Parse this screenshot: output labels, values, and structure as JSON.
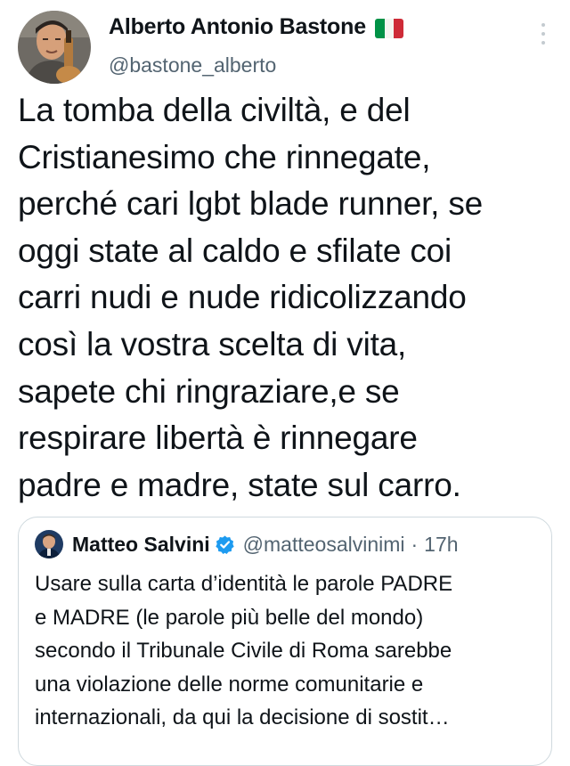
{
  "author": {
    "display_name": "Alberto Antonio Bastone",
    "handle": "@bastone_alberto",
    "flag_colors": [
      "#009246",
      "#ffffff",
      "#ce2b37"
    ]
  },
  "tweet": {
    "lines": [
      "La tomba della civiltà, e del",
      "Cristianesimo che rinnegate,",
      "perché cari lgbt blade runner, se",
      "oggi state al caldo e sfilate coi",
      "carri nudi e nude ridicolizzando",
      "così la vostra scelta di vita,",
      "sapete chi ringraziare,e se",
      "respirare libertà è rinnegare",
      "padre e madre, state sul carro."
    ]
  },
  "quoted": {
    "display_name": "Matteo Salvini",
    "handle": "@matteosalvinimi",
    "separator": "·",
    "time": "17h",
    "lines": [
      "Usare sulla carta d’identità le parole PADRE",
      "e MADRE (le parole più belle del mondo)",
      "secondo il Tribunale Civile di Roma sarebbe",
      "una violazione delle norme comunitarie e",
      "internazionali, da qui la decisione di sostit…"
    ]
  },
  "icons": {
    "more": "more-options-icon",
    "verified": "verified-badge-icon",
    "flag": "italy-flag-icon"
  },
  "colors": {
    "text": "#0f1419",
    "secondary": "#536471",
    "border": "#cfd9de",
    "verified": "#1d9bf0"
  }
}
